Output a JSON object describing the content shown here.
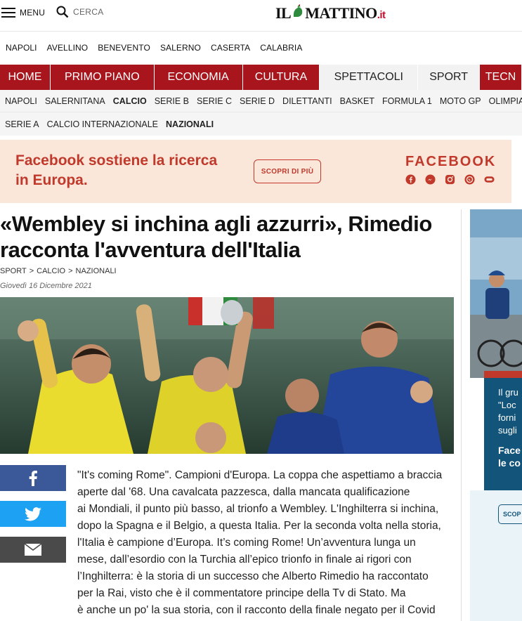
{
  "header": {
    "menu_label": "MENU",
    "search_label": "CERCA",
    "logo_text": "IL MATTINO",
    "logo_suffix": ".it"
  },
  "cities": [
    "NAPOLI",
    "AVELLINO",
    "BENEVENTO",
    "SALERNO",
    "CASERTA",
    "CALABRIA"
  ],
  "main_nav": [
    {
      "label": "HOME",
      "active": false
    },
    {
      "label": "PRIMO PIANO",
      "active": false
    },
    {
      "label": "ECONOMIA",
      "active": false
    },
    {
      "label": "CULTURA",
      "active": false
    },
    {
      "label": "SPETTACOLI",
      "active": true
    },
    {
      "label": "SPORT",
      "active": true
    },
    {
      "label": "TECN",
      "active": false
    }
  ],
  "sub_nav": [
    "NAPOLI",
    "SALERNITANA",
    "CALCIO",
    "SERIE B",
    "SERIE C",
    "SERIE D",
    "DILETTANTI",
    "BASKET",
    "FORMULA 1",
    "MOTO GP",
    "OLIMPIADI"
  ],
  "sub_nav_active": "CALCIO",
  "sub_nav2": [
    "SERIE A",
    "CALCIO INTERNAZIONALE",
    "NAZIONALI"
  ],
  "sub_nav2_active": "NAZIONALI",
  "ad": {
    "headline": "Facebook sostiene la ricerca in Europa.",
    "cta": "SCOPRI DI PIÙ",
    "brand": "FACEBOOK",
    "icons": [
      "facebook-icon",
      "messenger-icon",
      "instagram-icon",
      "whatsapp-icon",
      "oculus-icon"
    ]
  },
  "article": {
    "title": "«Wembley si inchina agli azzurri», Rimedio racconta l'avventura dell'Italia",
    "breadcrumb": [
      "SPORT",
      "CALCIO",
      "NAZIONALI"
    ],
    "breadcrumb_sep": ">",
    "date": "Giovedì 16 Dicembre 2021",
    "body_lines": [
      "\"It's coming Rome\". Campioni d'Europa. La coppa che aspettiamo a braccia",
      "aperte dal '68. Una cavalcata pazzesca, dalla mancata qualificazione",
      "ai Mondiali, il punto più basso, al trionfo a Wembley. L'Inghilterra si inchina,",
      "dopo la Spagna e il Belgio, a questa Italia. Per la seconda volta nella storia,",
      "l'Italia è campione d’Europa. It’s coming Rome! Un’avventura lunga un",
      "mese, dall’esordio con la Turchia all’epico trionfo in finale ai rigori con",
      "l’Inghilterra: è la storia di un successo che Alberto Rimedio ha raccontato",
      "per la Rai, visto che è il commentatore principe della Tv di Stato. Ma",
      "è anche un po' la sua storia, con il racconto della finale negato per il Covid"
    ]
  },
  "share": [
    "facebook-share-icon",
    "twitter-share-icon",
    "email-share-icon"
  ],
  "rail_ad": {
    "lines": [
      "Il gru",
      "\"Loc",
      "forni",
      "sugli"
    ],
    "bold_lines": [
      "Face",
      "le co"
    ],
    "cta": "SCOP"
  },
  "colors": {
    "brand_red": "#a8151c",
    "ad_bg": "#fbe7da",
    "ad_red": "#c0392b",
    "facebook_blue": "#3b5998",
    "twitter_blue": "#1da1f2",
    "email_gray": "#4a4a4a",
    "rail_blue": "#13547a"
  }
}
